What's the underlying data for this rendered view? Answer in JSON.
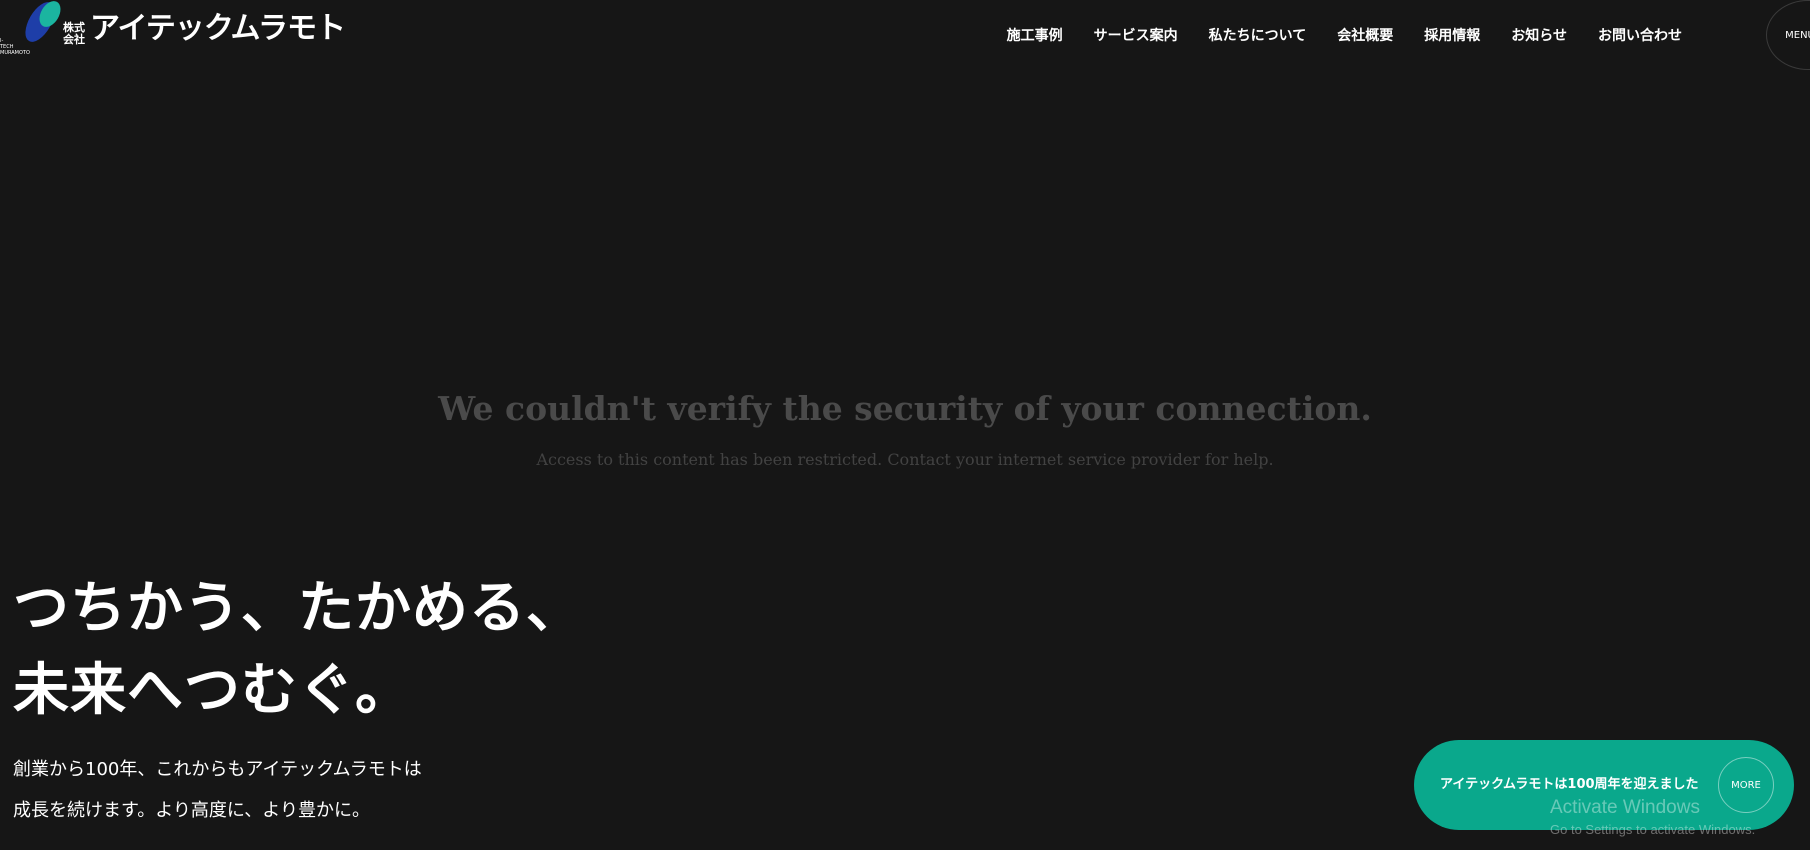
{
  "header": {
    "logo": {
      "kabushiki": "株式会社",
      "name": "アイテックムラモト",
      "tiny": "I-TECH MURAMOTO",
      "colors": {
        "green": "#1bb5a0",
        "blue": "#1e3ea8"
      }
    },
    "nav": [
      {
        "label": "施工事例"
      },
      {
        "label": "サービス案内"
      },
      {
        "label": "私たちについて"
      },
      {
        "label": "会社概要"
      },
      {
        "label": "採用情報"
      },
      {
        "label": "お知らせ"
      },
      {
        "label": "お問い合わせ"
      }
    ],
    "menu_label": "MENU"
  },
  "error": {
    "title": "We couldn't verify the security of your connection.",
    "message": "Access to this content has been restricted. Contact your internet service provider for help."
  },
  "hero": {
    "headline_line1": "つちかう、たかめる、",
    "headline_line2": "未来へつむぐ。",
    "sub_line1": "創業から100年、これからもアイテックムラモトは",
    "sub_line2": "成長を続けます。より高度に、より豊かに。"
  },
  "anniversary": {
    "text": "アイテックムラモトは100周年を迎えました",
    "more_label": "MORE",
    "color": "#0aa88c"
  },
  "watermark": {
    "title": "Activate Windows",
    "subtitle": "Go to Settings to activate Windows."
  }
}
